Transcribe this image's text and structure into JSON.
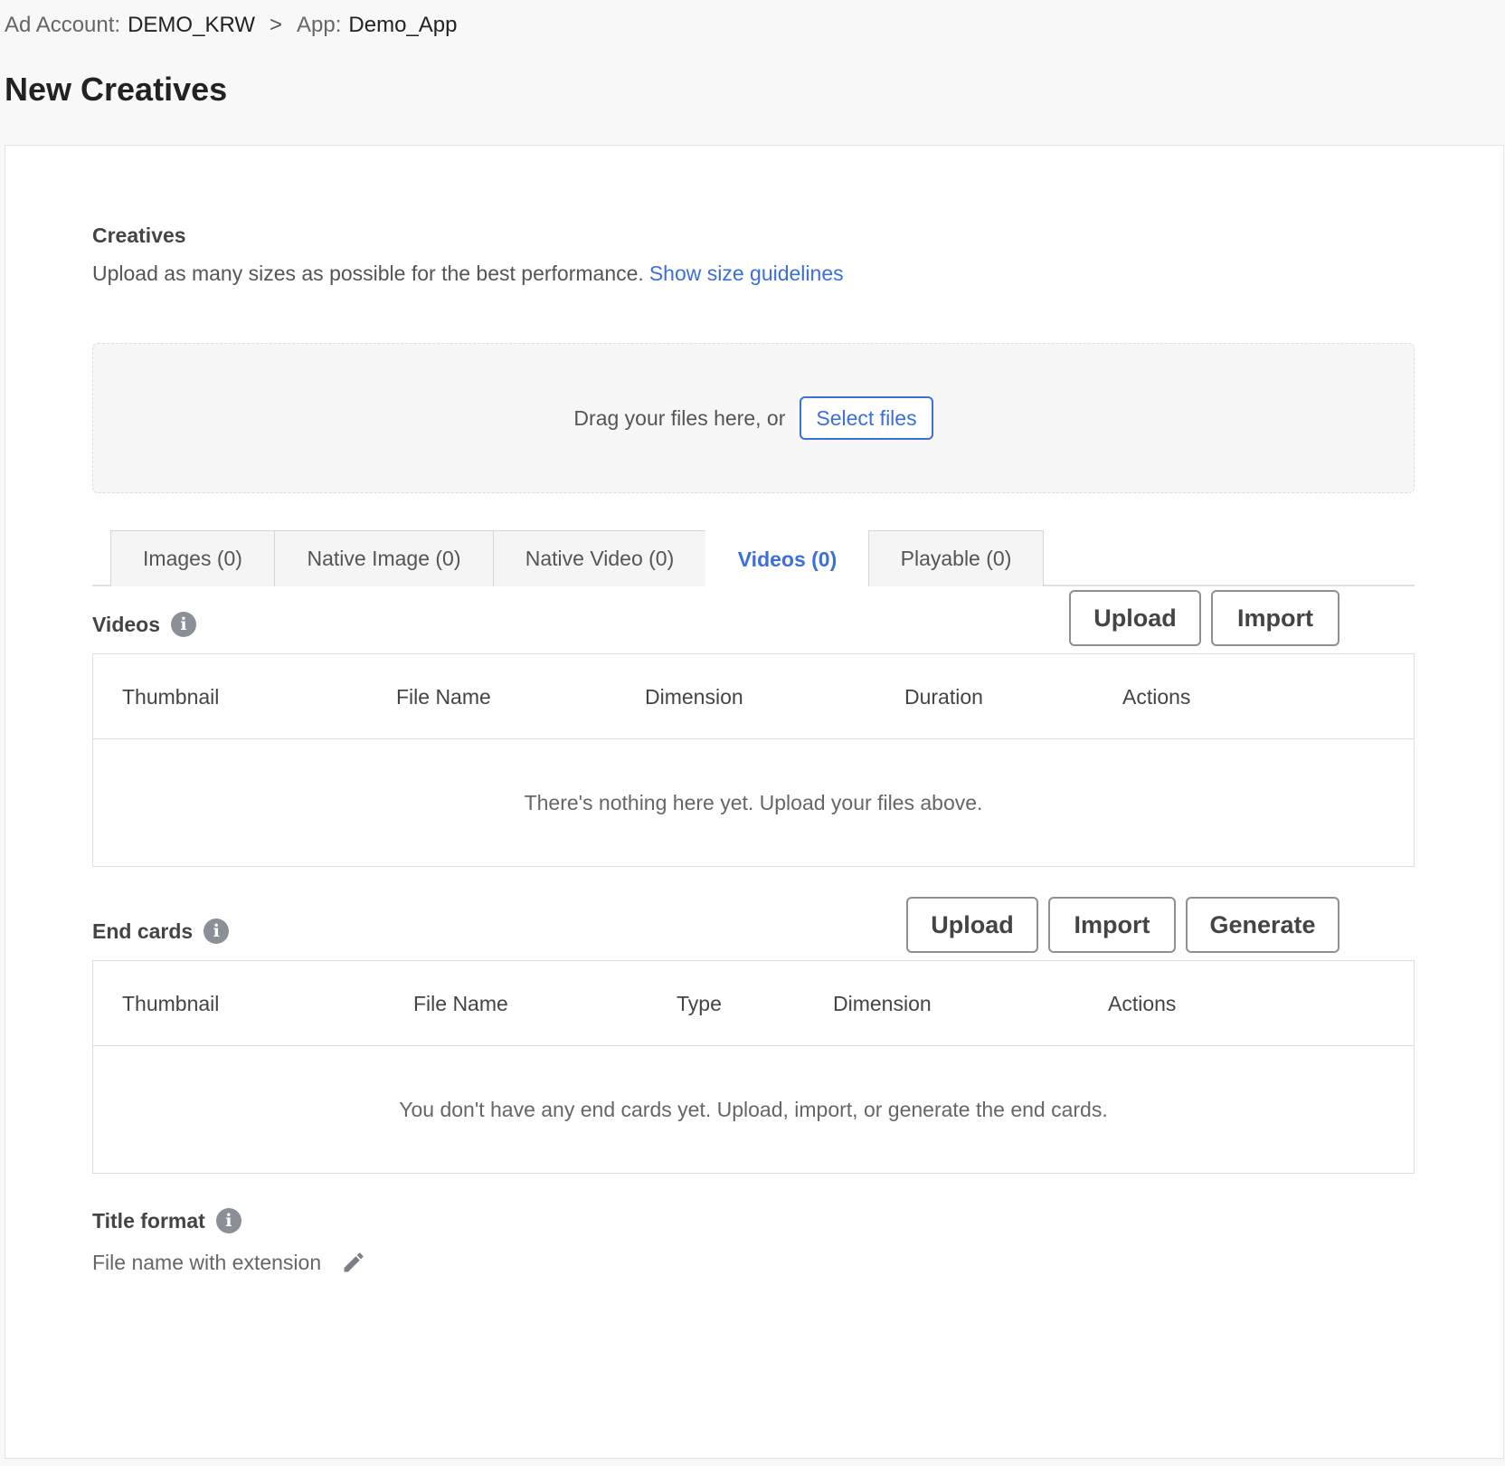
{
  "breadcrumb": {
    "account_label": "Ad Account:",
    "account_value": "DEMO_KRW",
    "separator": ">",
    "app_label": "App:",
    "app_value": "Demo_App"
  },
  "page_title": "New Creatives",
  "creatives": {
    "heading": "Creatives",
    "subtitle": "Upload as many sizes as possible for the best performance.",
    "guidelines_link": "Show size guidelines",
    "dropzone_text": "Drag your files here, or",
    "select_files": "Select files"
  },
  "tabs": [
    {
      "label": "Images (0)",
      "active": false
    },
    {
      "label": "Native Image (0)",
      "active": false
    },
    {
      "label": "Native Video (0)",
      "active": false
    },
    {
      "label": "Videos (0)",
      "active": true
    },
    {
      "label": "Playable (0)",
      "active": false
    }
  ],
  "videos": {
    "heading": "Videos",
    "upload": "Upload",
    "import": "Import",
    "columns": [
      "Thumbnail",
      "File Name",
      "Dimension",
      "Duration",
      "Actions"
    ],
    "empty_text": "There's nothing here yet. Upload your files above."
  },
  "end_cards": {
    "heading": "End cards",
    "upload": "Upload",
    "import": "Import",
    "generate": "Generate",
    "columns": [
      "Thumbnail",
      "File Name",
      "Type",
      "Dimension",
      "Actions"
    ],
    "empty_text": "You don't have any end cards yet. Upload, import, or generate the end cards."
  },
  "title_format": {
    "heading": "Title format",
    "value": "File name with extension"
  },
  "colors": {
    "accent": "#3b6fd9",
    "info_icon": "#8a8f98"
  }
}
